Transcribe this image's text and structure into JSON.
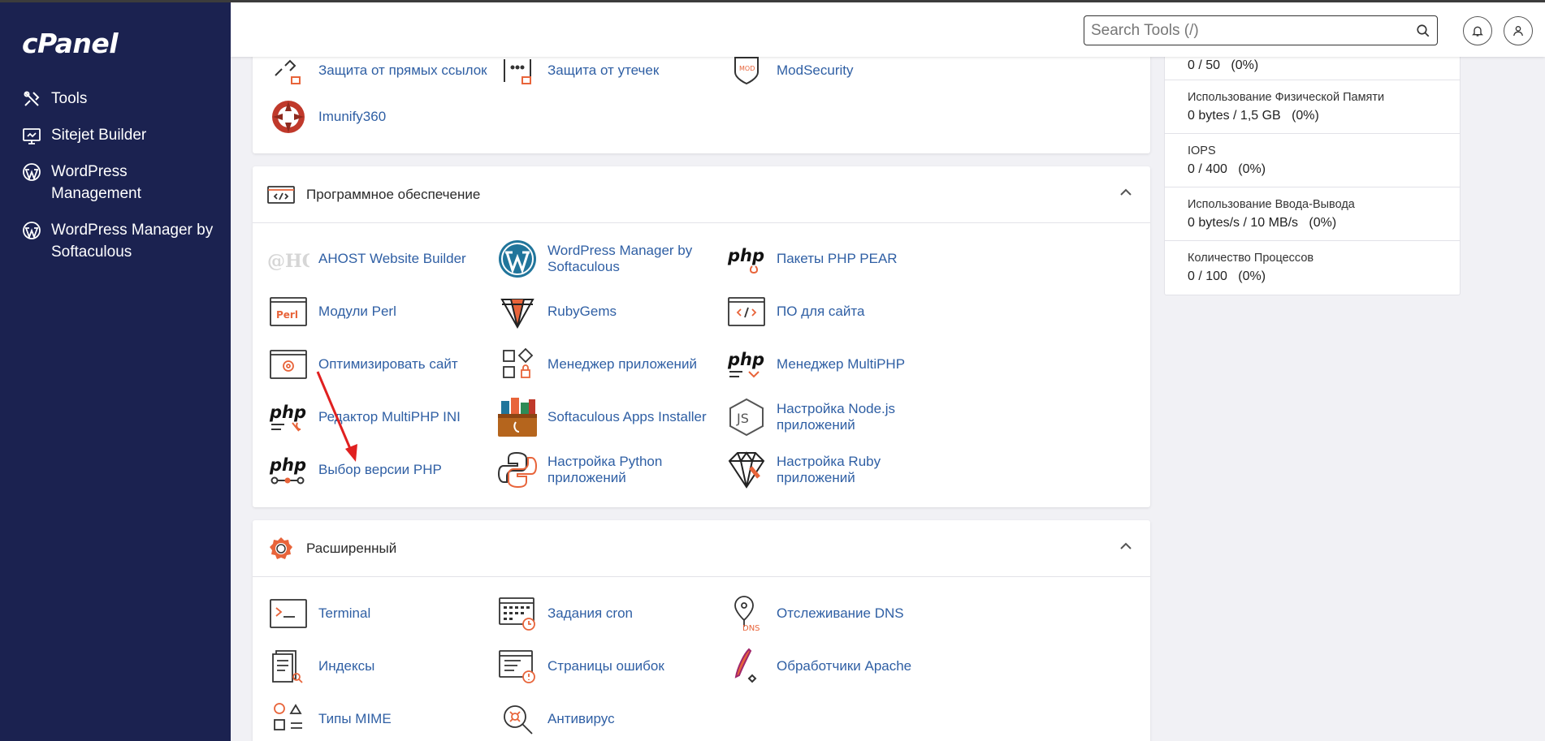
{
  "app": {
    "logo": "cPanel"
  },
  "sidebar": {
    "items": [
      {
        "label": "Tools",
        "icon": "tools-icon"
      },
      {
        "label": "Sitejet Builder",
        "icon": "sitejet-icon"
      },
      {
        "label": "WordPress Management",
        "icon": "wordpress-icon"
      },
      {
        "label": "WordPress Manager by Softaculous",
        "icon": "wordpress-icon"
      }
    ]
  },
  "header": {
    "search_placeholder": "Search Tools (/)",
    "icons": [
      "search-icon",
      "bell-icon",
      "user-icon"
    ]
  },
  "security_panel": {
    "tools": [
      {
        "label": "Защита от прямых ссылок",
        "icon": "hotlink-protection-icon"
      },
      {
        "label": "Защита от утечек",
        "icon": "leech-protection-icon"
      },
      {
        "label": "ModSecurity",
        "icon": "modsecurity-icon"
      },
      {
        "label": "Imunify360",
        "icon": "imunify360-icon"
      }
    ]
  },
  "software_panel": {
    "title": "Программное обеспечение",
    "tools": [
      {
        "label": "AHOST Website Builder",
        "icon": "ahost-icon"
      },
      {
        "label": "WordPress Manager by Softaculous",
        "icon": "wordpress-icon"
      },
      {
        "label": "Пакеты PHP PEAR",
        "icon": "php-pear-icon"
      },
      {
        "label": "Модули Perl",
        "icon": "perl-icon"
      },
      {
        "label": "RubyGems",
        "icon": "rubygems-icon"
      },
      {
        "label": "ПО для сайта",
        "icon": "site-software-icon"
      },
      {
        "label": "Оптимизировать сайт",
        "icon": "optimize-icon"
      },
      {
        "label": "Менеджер приложений",
        "icon": "app-manager-icon"
      },
      {
        "label": "Менеджер MultiPHP",
        "icon": "multiphp-manager-icon"
      },
      {
        "label": "Редактор MultiPHP INI",
        "icon": "multiphp-ini-icon"
      },
      {
        "label": "Softaculous Apps Installer",
        "icon": "softaculous-icon"
      },
      {
        "label": "Настройка Node.js приложений",
        "icon": "nodejs-icon"
      },
      {
        "label": "Выбор версии PHP",
        "icon": "php-version-icon"
      },
      {
        "label": "Настройка Python приложений",
        "icon": "python-icon"
      },
      {
        "label": "Настройка Ruby приложений",
        "icon": "ruby-icon"
      }
    ]
  },
  "advanced_panel": {
    "title": "Расширенный",
    "tools": [
      {
        "label": "Terminal",
        "icon": "terminal-icon"
      },
      {
        "label": "Задания cron",
        "icon": "cron-icon"
      },
      {
        "label": "Отслеживание DNS",
        "icon": "dns-icon"
      },
      {
        "label": "Индексы",
        "icon": "indexes-icon"
      },
      {
        "label": "Страницы ошибок",
        "icon": "error-pages-icon"
      },
      {
        "label": "Обработчики Apache",
        "icon": "apache-handlers-icon"
      },
      {
        "label": "Типы MIME",
        "icon": "mime-icon"
      },
      {
        "label": "Антивирус",
        "icon": "antivirus-icon"
      }
    ]
  },
  "stats": [
    {
      "name": "",
      "value": "0 / 50   (0%)"
    },
    {
      "name": "Использование Физической Памяти",
      "value": "0 bytes / 1,5 GB   (0%)"
    },
    {
      "name": "IOPS",
      "value": "0 / 400   (0%)"
    },
    {
      "name": "Использование Ввода-Вывода",
      "value": "0 bytes/s / 10 MB/s   (0%)"
    },
    {
      "name": "Количество Процессов",
      "value": "0 / 100   (0%)"
    }
  ],
  "colors": {
    "sidebar": "#1b2250",
    "link": "#2f5fa4",
    "accent": "#e8643a",
    "annotation_arrow": "#e02020"
  }
}
